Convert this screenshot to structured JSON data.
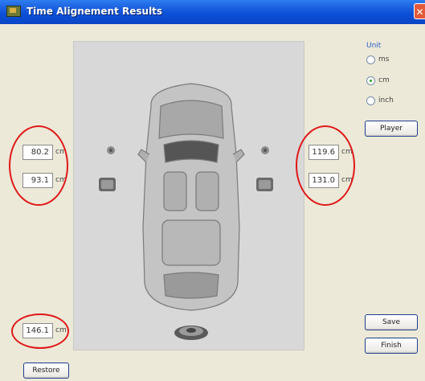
{
  "window": {
    "title": "Time Alignement Results",
    "close_label": "✕"
  },
  "fields": {
    "front_left": {
      "value": "80.2",
      "unit": "cm"
    },
    "rear_left": {
      "value": "93.1",
      "unit": "cm"
    },
    "front_right": {
      "value": "119.6",
      "unit": "cm"
    },
    "rear_right": {
      "value": "131.0",
      "unit": "cm"
    },
    "subwoofer": {
      "value": "146.1",
      "unit": "cm"
    }
  },
  "unit_group": {
    "title": "Unit",
    "options": [
      {
        "label": "ms",
        "selected": false
      },
      {
        "label": "cm",
        "selected": true
      },
      {
        "label": "inch",
        "selected": false
      }
    ]
  },
  "buttons": {
    "player": "Player",
    "save": "Save",
    "finish": "Finish",
    "restore": "Restore"
  },
  "colors": {
    "title_bar": "#0B4FD8",
    "window_bg": "#ECE9D8",
    "highlight": "#e01818",
    "radio_selected": "#28a428"
  }
}
